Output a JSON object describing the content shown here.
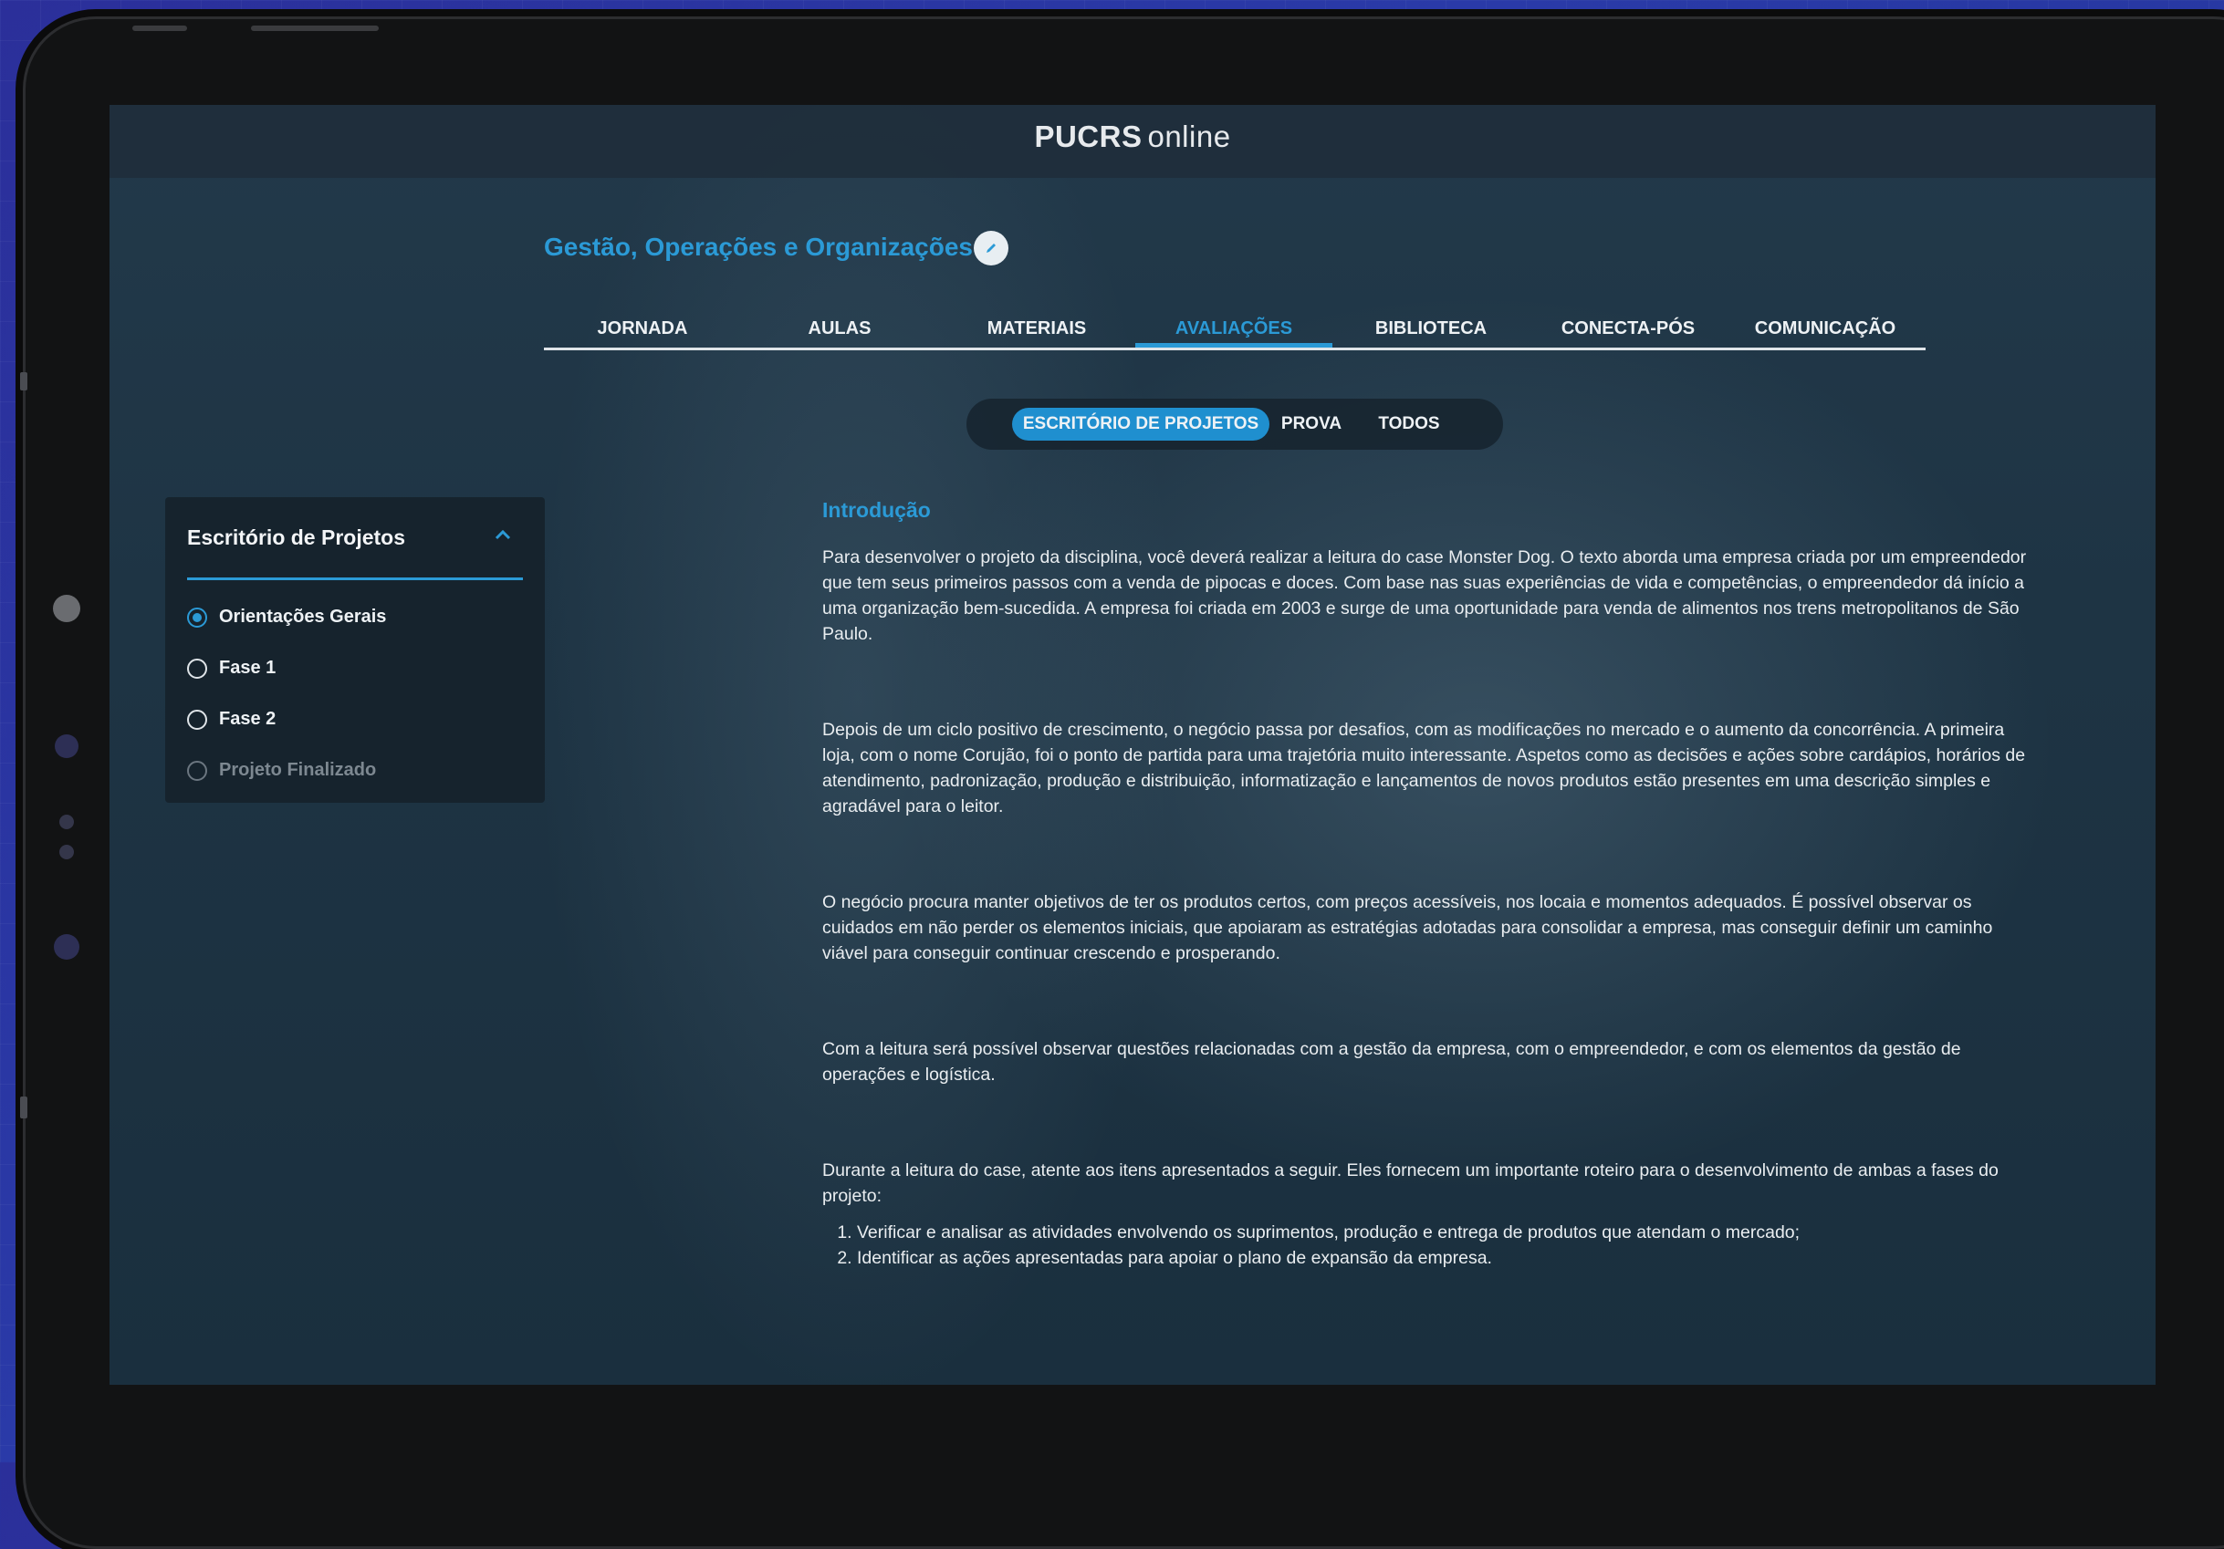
{
  "header": {
    "logo_bold": "PUCRS",
    "logo_light": "online"
  },
  "course": {
    "title": "Gestão, Operações e Organizações",
    "edit_icon": "pencil-icon"
  },
  "tabs": [
    {
      "label": "JORNADA",
      "active": false
    },
    {
      "label": "AULAS",
      "active": false
    },
    {
      "label": "MATERIAIS",
      "active": false
    },
    {
      "label": "AVALIAÇÕES",
      "active": true
    },
    {
      "label": "BIBLIOTECA",
      "active": false
    },
    {
      "label": "CONECTA-PÓS",
      "active": false
    },
    {
      "label": "COMUNICAÇÃO",
      "active": false
    }
  ],
  "filters": [
    {
      "label": "ESCRITÓRIO DE PROJETOS",
      "active": true
    },
    {
      "label": "PROVA",
      "active": false
    },
    {
      "label": "TODOS",
      "active": false
    }
  ],
  "sidebar": {
    "title": "Escritório de Projetos",
    "collapse_icon": "chevron-up-icon",
    "items": [
      {
        "label": "Orientações Gerais",
        "selected": true,
        "disabled": false
      },
      {
        "label": "Fase 1",
        "selected": false,
        "disabled": false
      },
      {
        "label": "Fase 2",
        "selected": false,
        "disabled": false
      },
      {
        "label": "Projeto Finalizado",
        "selected": false,
        "disabled": true
      }
    ]
  },
  "content": {
    "title": "Introdução",
    "paragraphs": [
      "Para desenvolver o projeto da disciplina, você deverá realizar a leitura do case Monster Dog. O texto aborda uma empresa criada por um empreendedor que tem seus primeiros passos com a venda de pipocas e doces. Com base nas suas experiências de vida e competências, o empreendedor dá início a uma organização bem-sucedida. A empresa foi criada em 2003 e surge de uma oportunidade para venda de alimentos nos trens metropolitanos de São Paulo.",
      "Depois de um ciclo positivo de crescimento, o negócio passa por desafios, com as modificações no mercado e o aumento da concorrência. A primeira loja, com o nome Corujão, foi o ponto de partida para uma trajetória muito interessante. Aspetos como as decisões e ações sobre cardápios, horários de atendimento, padronização, produção e distribuição, informatização e lançamentos de novos produtos estão presentes em uma descrição simples e agradável para o leitor.",
      "O negócio procura manter objetivos de ter os produtos certos, com preços acessíveis, nos locaia e momentos adequados. É possível observar os cuidados em não perder os elementos iniciais, que apoiaram as estratégias adotadas para consolidar a empresa, mas conseguir definir um caminho viável para conseguir continuar crescendo e prosperando.",
      "Com a leitura será possível observar questões relacionadas com a gestão da empresa, com o empreendedor, e com os elementos da gestão de operações e logística.",
      "Durante a leitura do case, atente aos itens apresentados a seguir. Eles fornecem um importante roteiro para o desenvolvimento de ambas a fases do projeto:"
    ],
    "list": [
      "Verificar e analisar as atividades envolvendo os suprimentos, produção e entrega de produtos que atendam o mercado;",
      "Identificar as ações apresentadas para apoiar o plano de expansão da empresa."
    ]
  },
  "colors": {
    "accent": "#2b9ad6",
    "background": "#1e3444",
    "page_bg": "#2a3aa8"
  }
}
